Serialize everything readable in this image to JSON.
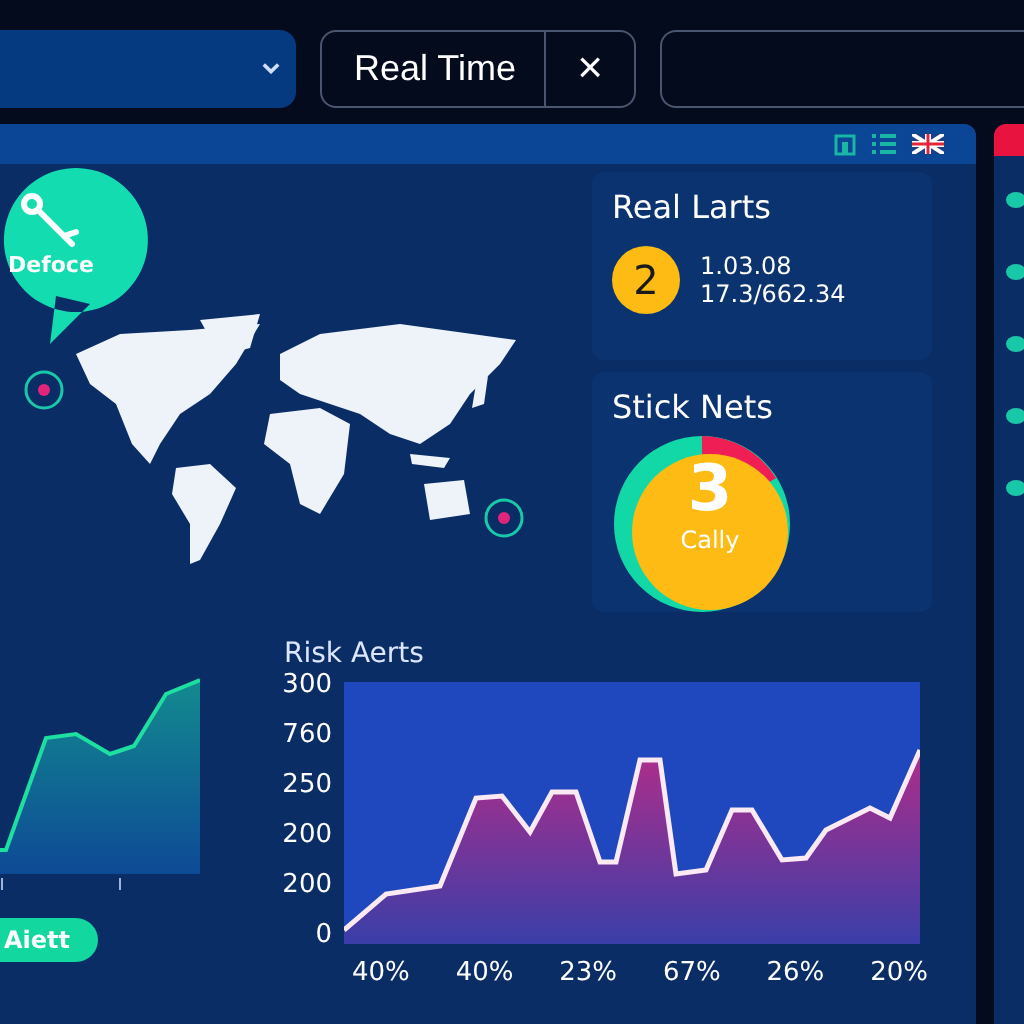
{
  "toolbar": {
    "mode_button": "Real Time",
    "close_button": "×"
  },
  "map": {
    "callout": "Defoce"
  },
  "cards": [
    {
      "kind": "badge",
      "title": "Real Larts",
      "badge": "2",
      "lines": [
        "1.03.08",
        "17.3/662.34"
      ]
    },
    {
      "kind": "donut",
      "title": "Stick Nets",
      "value": "3",
      "caption": "Cally"
    }
  ],
  "mini_chart": {
    "alert": "Aiett"
  },
  "risk_chart": {
    "title": "Risk Aerts",
    "y_labels": [
      "300",
      "760",
      "250",
      "200",
      "200",
      "0"
    ],
    "x_labels": [
      "40%",
      "40%",
      "23%",
      "67%",
      "26%",
      "20%"
    ]
  }
}
